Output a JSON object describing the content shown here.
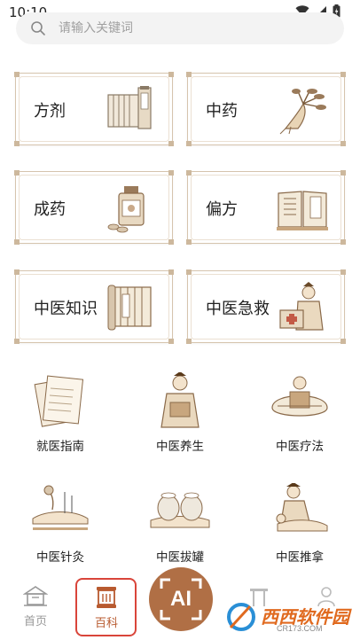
{
  "status_bar": {
    "time": "10:10"
  },
  "search": {
    "placeholder": "请输入关键词"
  },
  "cards": [
    {
      "label": "方剂",
      "icon": "scroll-book-icon"
    },
    {
      "label": "中药",
      "icon": "ginseng-root-icon"
    },
    {
      "label": "成药",
      "icon": "medicine-bottle-icon"
    },
    {
      "label": "偏方",
      "icon": "open-book-icon"
    },
    {
      "label": "中医知识",
      "icon": "bamboo-scroll-icon"
    },
    {
      "label": "中医急救",
      "icon": "doctor-first-aid-icon"
    }
  ],
  "grid": [
    {
      "label": "就医指南",
      "icon": "paper-stack-icon"
    },
    {
      "label": "中医养生",
      "icon": "doctor-holding-box-icon"
    },
    {
      "label": "中医疗法",
      "icon": "treatment-tools-icon"
    },
    {
      "label": "中医针灸",
      "icon": "acupuncture-icon"
    },
    {
      "label": "中医拔罐",
      "icon": "cupping-icon"
    },
    {
      "label": "中医推拿",
      "icon": "massage-icon"
    }
  ],
  "bottom_nav": {
    "home": "首页",
    "encyclopedia": "百科",
    "ai_button": "AI"
  },
  "watermark": {
    "brand": "西西软件园",
    "site": "CR173.COM"
  },
  "colors": {
    "accent": "#b85a2f",
    "card_border": "#d6c4ad",
    "highlight": "#d9453a",
    "ai_button": "#b06f45"
  }
}
